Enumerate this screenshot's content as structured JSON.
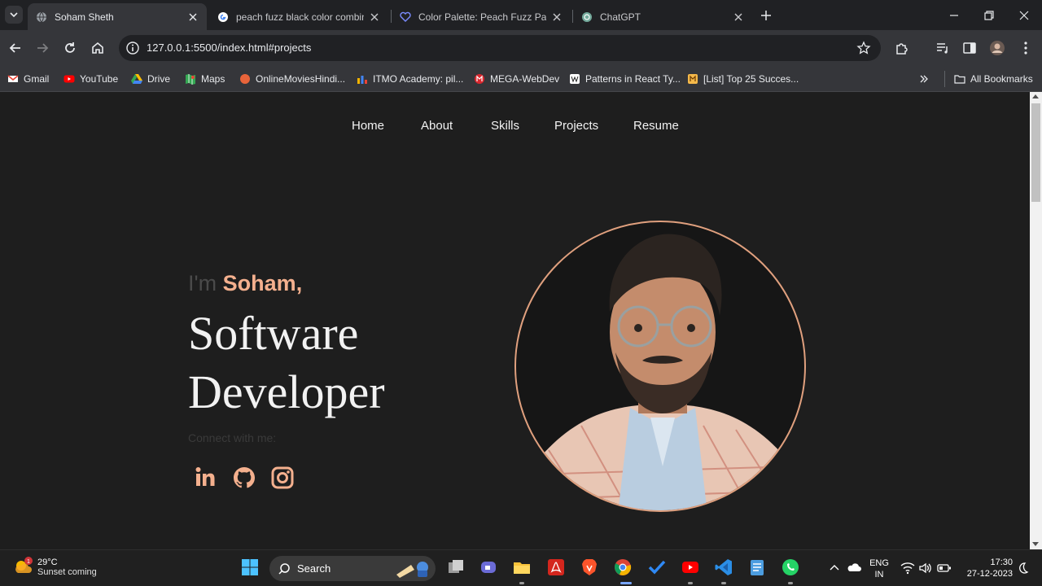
{
  "browser": {
    "tabs": [
      {
        "title": "Soham Sheth",
        "active": true
      },
      {
        "title": "peach fuzz black color combina",
        "active": false
      },
      {
        "title": "Color Palette: Peach Fuzz Panto",
        "active": false
      },
      {
        "title": "ChatGPT",
        "active": false
      }
    ],
    "url": "127.0.0.1:5500/index.html#projects",
    "bookmarks": [
      {
        "label": "Gmail"
      },
      {
        "label": "YouTube"
      },
      {
        "label": "Drive"
      },
      {
        "label": "Maps"
      },
      {
        "label": "OnlineMoviesHindi..."
      },
      {
        "label": "ITMO Academy: pil..."
      },
      {
        "label": "MEGA-WebDev"
      },
      {
        "label": "Patterns in React Ty..."
      },
      {
        "label": "[List] Top 25 Succes..."
      }
    ],
    "all_bookmarks": "All Bookmarks"
  },
  "site": {
    "nav": [
      "Home",
      "About",
      "Skills",
      "Projects",
      "Resume"
    ],
    "intro_prefix": "I'm",
    "intro_name": "Soham,",
    "role_line1": "Software",
    "role_line2": "Developer",
    "connect_label": "Connect with me:",
    "social": [
      "linkedin-icon",
      "github-icon",
      "instagram-icon"
    ],
    "accent_color": "#f4b08e"
  },
  "taskbar": {
    "weather_badge": "1",
    "temperature": "29°C",
    "weather_text": "Sunset coming",
    "search_label": "Search",
    "language_line1": "ENG",
    "language_line2": "IN",
    "time": "17:30",
    "date": "27-12-2023"
  }
}
